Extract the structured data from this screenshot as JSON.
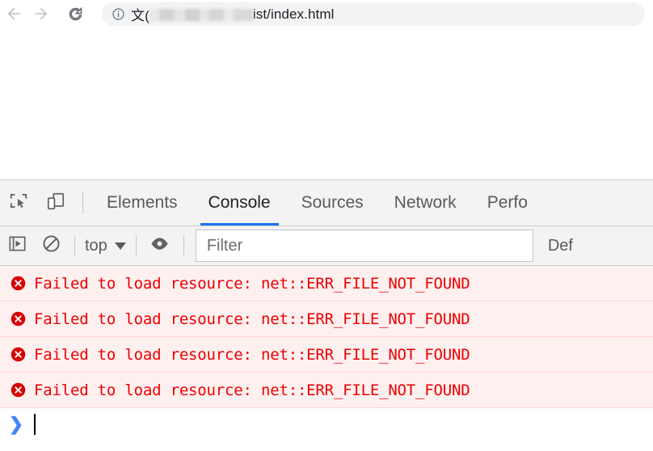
{
  "browser": {
    "back_icon": "arrow-left-icon",
    "forward_icon": "arrow-right-icon",
    "reload_icon": "reload-icon",
    "info_icon": "info-circle-icon",
    "url_prefix": "文(",
    "url_redacted": "",
    "url_suffix": "ist/index.html",
    "url_full_visible": "文(██████ist/index.html"
  },
  "devtools": {
    "icons": {
      "inspect": "inspect-element-icon",
      "device": "device-toolbar-icon"
    },
    "tabs": [
      {
        "label": "Elements",
        "active": false
      },
      {
        "label": "Console",
        "active": true
      },
      {
        "label": "Sources",
        "active": false
      },
      {
        "label": "Network",
        "active": false
      },
      {
        "label": "Perfo",
        "active": false
      }
    ],
    "console_toolbar": {
      "execute_icon": "execute-snippet-icon",
      "clear_icon": "clear-console-icon",
      "context_label": "top",
      "context_caret": "chevron-down-icon",
      "eye_icon": "live-expression-eye-icon",
      "filter_placeholder": "Filter",
      "filter_value": "",
      "levels_label": "Def"
    },
    "messages": [
      {
        "level": "error",
        "icon": "error-circle-icon",
        "text": "Failed to load resource: net::ERR_FILE_NOT_FOUND"
      },
      {
        "level": "error",
        "icon": "error-circle-icon",
        "text": "Failed to load resource: net::ERR_FILE_NOT_FOUND"
      },
      {
        "level": "error",
        "icon": "error-circle-icon",
        "text": "Failed to load resource: net::ERR_FILE_NOT_FOUND"
      },
      {
        "level": "error",
        "icon": "error-circle-icon",
        "text": "Failed to load resource: net::ERR_FILE_NOT_FOUND"
      }
    ],
    "prompt": {
      "caret": "❯",
      "value": ""
    }
  },
  "colors": {
    "accent_blue": "#1a73e8",
    "error_red": "#eb0000",
    "error_bg": "#fff0f0",
    "error_border": "#ffd6d6",
    "toolbar_bg": "#f3f3f3",
    "omnibox_bg": "#f1f3f4",
    "prompt_blue": "#4285f4"
  }
}
